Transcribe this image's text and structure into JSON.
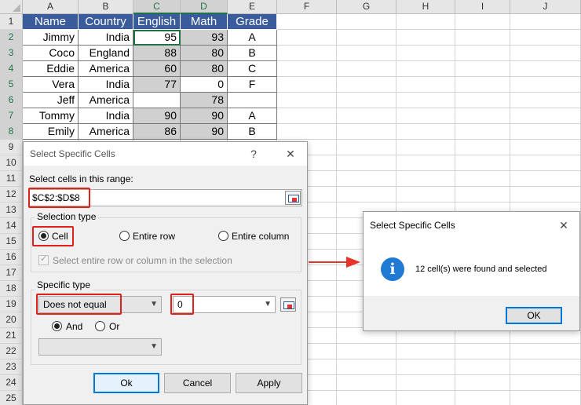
{
  "sheet": {
    "columns": [
      "A",
      "B",
      "C",
      "D",
      "E",
      "F",
      "G",
      "H",
      "I",
      "J"
    ],
    "rows": [
      "1",
      "2",
      "3",
      "4",
      "5",
      "6",
      "7",
      "8",
      "9",
      "10",
      "11",
      "12",
      "13",
      "14",
      "15",
      "16",
      "17",
      "18",
      "19",
      "20",
      "21",
      "22",
      "23",
      "24",
      "25"
    ],
    "table_header": [
      "Name",
      "Country",
      "English",
      "Math",
      "Grade"
    ],
    "table_rows": [
      [
        "Jimmy",
        "India",
        "95",
        "93",
        "A"
      ],
      [
        "Coco",
        "England",
        "88",
        "80",
        "B"
      ],
      [
        "Eddie",
        "America",
        "60",
        "80",
        "C"
      ],
      [
        "Vera",
        "India",
        "77",
        "0",
        "F"
      ],
      [
        "Jeff",
        "America",
        "",
        "78",
        ""
      ],
      [
        "Tommy",
        "India",
        "90",
        "90",
        "A"
      ],
      [
        "Emily",
        "America",
        "86",
        "90",
        "B"
      ]
    ]
  },
  "select_dialog": {
    "title": "Select Specific Cells",
    "help_glyph": "?",
    "close_glyph": "✕",
    "range_label": "Select cells in this range:",
    "range_value": "$C$2:$D$8",
    "selection_type_title": "Selection type",
    "options": {
      "cell": "Cell",
      "entire_row": "Entire row",
      "entire_column": "Entire column"
    },
    "select_entire_label": "Select entire row or column in the selection",
    "specific_type_title": "Specific type",
    "condition1": "Does not equal",
    "value1": "0",
    "and_label": "And",
    "or_label": "Or",
    "condition2": "",
    "ok_label": "Ok",
    "cancel_label": "Cancel",
    "apply_label": "Apply"
  },
  "message_box": {
    "title": "Select Specific Cells",
    "close_glyph": "✕",
    "icon_glyph": "i",
    "message": "12 cell(s) were found and selected",
    "ok_label": "OK"
  },
  "colors": {
    "header_fill": "#3a5b9c",
    "highlight": "#e0201a",
    "accent": "#217346",
    "arrow": "#e8322a"
  }
}
